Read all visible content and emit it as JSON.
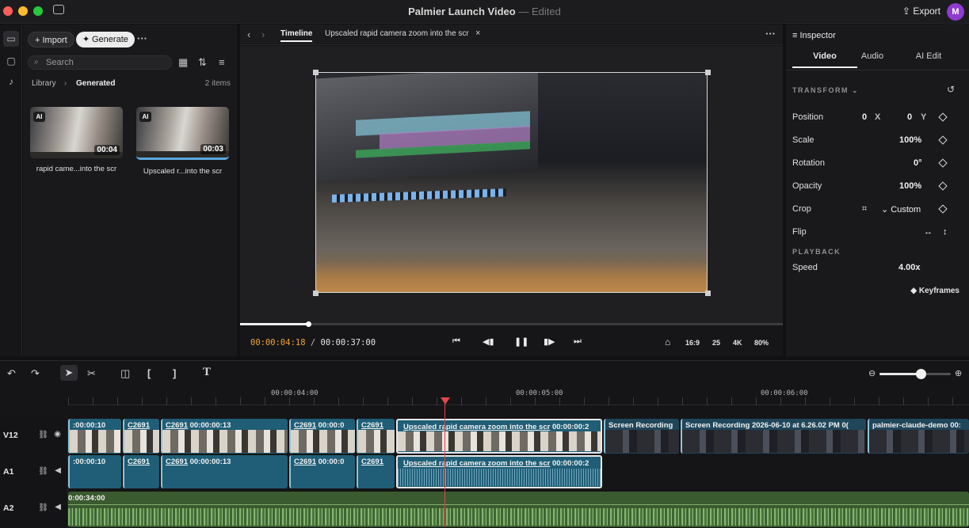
{
  "window": {
    "title": "Palmier Launch Video",
    "separator": "—",
    "status": "Edited",
    "export_label": "Export",
    "avatar_initial": "M"
  },
  "colors": {
    "accent": "#5aa7e0",
    "timecode": "#f0a33a",
    "playhead": "#e0474f",
    "clip": "#1f5e76",
    "audio_wave": "#6fa35f"
  },
  "media": {
    "import_label": "+ Import",
    "generate_label": "Generate",
    "search_placeholder": "Search",
    "breadcrumb": [
      "Library",
      "Generated"
    ],
    "item_count": "2 items",
    "items": [
      {
        "badge": "AI",
        "duration": "00:04",
        "caption": "rapid came...into the scr"
      },
      {
        "badge": "AI",
        "duration": "00:03",
        "caption": "Upscaled r...into the scr"
      }
    ]
  },
  "viewer": {
    "tabs": [
      {
        "label": "Timeline"
      },
      {
        "label": "Upscaled rapid camera zoom into the scr"
      }
    ],
    "timecode_current": "00:00:04:18",
    "timecode_sep": "/",
    "timecode_total": "00:00:37:00",
    "progress": 0.126,
    "options": [
      "16:9",
      "25",
      "4K",
      "80%"
    ]
  },
  "inspector": {
    "title": "Inspector",
    "tabs": [
      "Video",
      "Audio",
      "AI Edit"
    ],
    "transform_label": "TRANSFORM",
    "position": {
      "label": "Position",
      "x": "0",
      "x_axis": "X",
      "y": "0",
      "y_axis": "Y"
    },
    "scale": {
      "label": "Scale",
      "value": "100%"
    },
    "rotation": {
      "label": "Rotation",
      "value": "0°"
    },
    "opacity": {
      "label": "Opacity",
      "value": "100%"
    },
    "crop": {
      "label": "Crop",
      "value": "Custom"
    },
    "flip": {
      "label": "Flip"
    },
    "playback_label": "PLAYBACK",
    "speed": {
      "label": "Speed",
      "value": "4.00x"
    },
    "keyframes_label": "Keyframes"
  },
  "timeline": {
    "zoom_level": 0.58,
    "ruler": [
      "00:00:04:00",
      "00:00:05:00",
      "00:00:06:00"
    ],
    "tracks": [
      {
        "name": "V12"
      },
      {
        "name": "A1"
      },
      {
        "name": "A2"
      }
    ],
    "v12_clips": [
      {
        "label": ":00:00:10"
      },
      {
        "label": "C2691"
      },
      {
        "label": "C2691",
        "tc": "00:00:00:13"
      },
      {
        "label": "C2691",
        "tc": "00:00:0"
      },
      {
        "label": "C2691"
      },
      {
        "label": "Upscaled rapid camera zoom into the scr",
        "tc": "00:00:00:2"
      },
      {
        "label": "Screen Recording"
      },
      {
        "label": "Screen Recording 2026-06-10 at 6.26.02 PM",
        "tc": "0("
      },
      {
        "label": "palmier-claude-demo",
        "tc": "00:"
      }
    ],
    "a1_clips": [
      {
        "label": ":00:00:10"
      },
      {
        "label": "C2691"
      },
      {
        "label": "C2691",
        "tc": "00:00:00:13"
      },
      {
        "label": "C2691",
        "tc": "00:00:0"
      },
      {
        "label": "C2691"
      },
      {
        "label": "Upscaled rapid camera zoom into the scr",
        "tc": "00:00:00:2"
      }
    ],
    "a2_clip": {
      "label": "0:00:34:00"
    }
  }
}
